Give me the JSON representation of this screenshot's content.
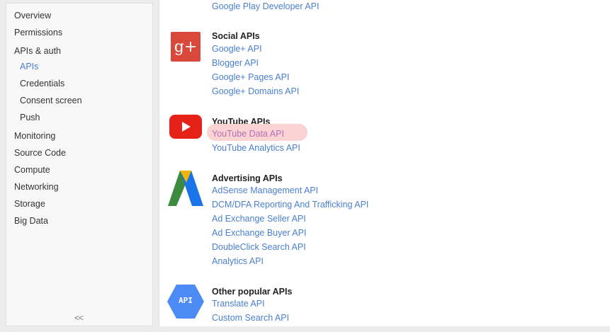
{
  "sidebar": {
    "items": [
      {
        "label": "Overview"
      },
      {
        "label": "Permissions"
      },
      {
        "label": "APIs & auth"
      },
      {
        "label": "APIs"
      },
      {
        "label": "Credentials"
      },
      {
        "label": "Consent screen"
      },
      {
        "label": "Push"
      },
      {
        "label": "Monitoring"
      },
      {
        "label": "Source Code"
      },
      {
        "label": "Compute"
      },
      {
        "label": "Networking"
      },
      {
        "label": "Storage"
      },
      {
        "label": "Big Data"
      }
    ],
    "collapse_label": "<<",
    "accent_color": "#4a7fd0"
  },
  "main": {
    "prev_link": "Google Play Developer API",
    "groups": [
      {
        "title": "Social APIs",
        "logo": "google-plus-icon",
        "logo_text": "g+",
        "links": [
          "Google+ API",
          "Blogger API",
          "Google+ Pages API",
          "Google+ Domains API"
        ]
      },
      {
        "title": "YouTube APIs",
        "logo": "youtube-icon",
        "links": [
          "YouTube Data API",
          "YouTube Analytics API"
        ]
      },
      {
        "title": "Advertising APIs",
        "logo": "adwords-icon",
        "links": [
          "AdSense Management API",
          "DCM/DFA Reporting And Trafficking API",
          "Ad Exchange Seller API",
          "Ad Exchange Buyer API",
          "DoubleClick Search API",
          "Analytics API"
        ]
      },
      {
        "title": "Other popular APIs",
        "logo": "api-hexagon-icon",
        "logo_text": "API",
        "links": [
          "Translate API",
          "Custom Search API"
        ]
      }
    ],
    "link_color": "#4a7fd0",
    "highlight_color": "#fcd3d3"
  }
}
